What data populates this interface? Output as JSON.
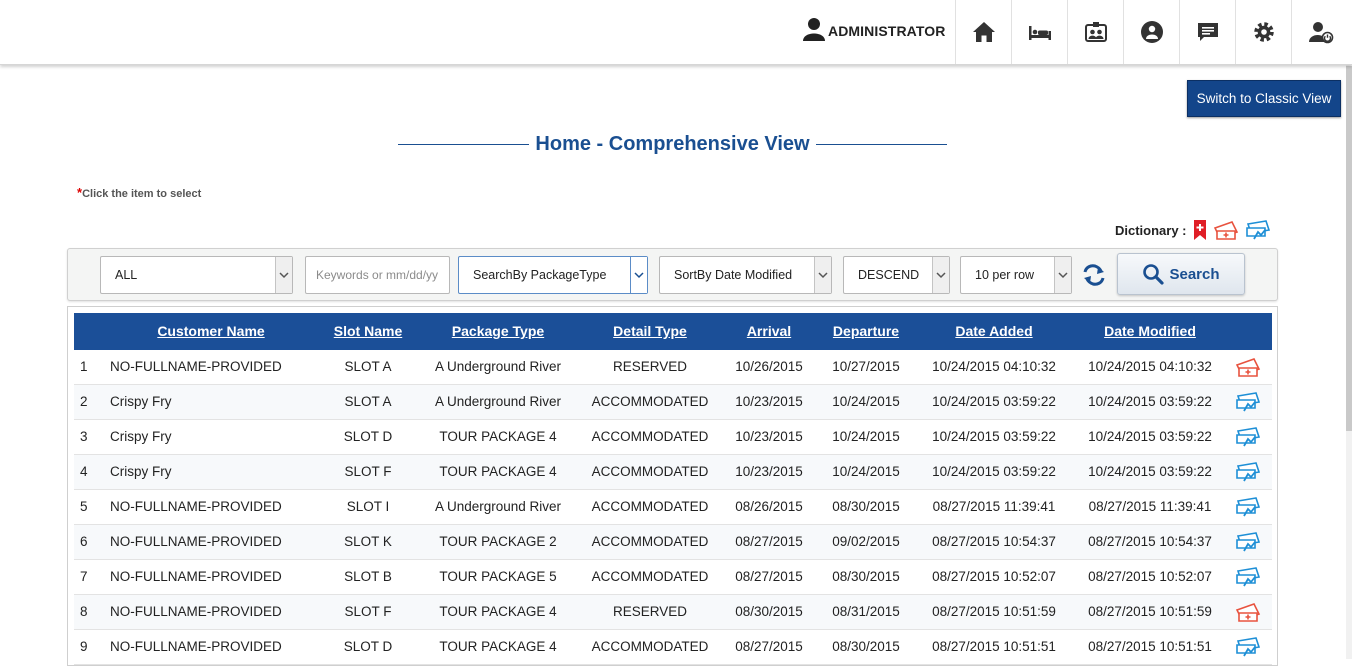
{
  "header": {
    "user_label": "ADMINISTRATOR",
    "nav_icons": [
      "home-icon",
      "bed-icon",
      "guest-card-icon",
      "support-icon",
      "message-icon",
      "settings-icon",
      "user-logout-icon"
    ]
  },
  "classic_view_button": "Switch to Classic View",
  "page_title": "Home - Comprehensive View",
  "hint": {
    "star": "*",
    "text": "Click the item to select"
  },
  "dictionary": {
    "label": "Dictionary :",
    "icons": [
      "bookmark-plus-icon",
      "reserved-icon",
      "accommodated-icon"
    ]
  },
  "filters": {
    "category": "ALL",
    "keyword_placeholder": "Keywords or mm/dd/yy",
    "search_by": "SearchBy PackageType",
    "sort_by": "SortBy Date Modified",
    "order": "DESCEND",
    "per_row": "10 per row",
    "search_button": "Search"
  },
  "table": {
    "headers": [
      "Customer Name",
      "Slot Name",
      "Package Type",
      "Detail Type",
      "Arrival",
      "Departure",
      "Date Added",
      "Date Modified"
    ],
    "rows": [
      {
        "no": "1",
        "customer": "NO-FULLNAME-PROVIDED",
        "slot": "SLOT A",
        "package": "A Underground River",
        "detail": "RESERVED",
        "arrival": "10/26/2015",
        "departure": "10/27/2015",
        "added": "10/24/2015 04:10:32",
        "modified": "10/24/2015 04:10:32",
        "icon": "reserved-icon"
      },
      {
        "no": "2",
        "customer": "Crispy Fry",
        "slot": "SLOT A",
        "package": "A Underground River",
        "detail": "ACCOMMODATED",
        "arrival": "10/23/2015",
        "departure": "10/24/2015",
        "added": "10/24/2015 03:59:22",
        "modified": "10/24/2015 03:59:22",
        "icon": "accommodated-icon"
      },
      {
        "no": "3",
        "customer": "Crispy Fry",
        "slot": "SLOT D",
        "package": "TOUR PACKAGE 4",
        "detail": "ACCOMMODATED",
        "arrival": "10/23/2015",
        "departure": "10/24/2015",
        "added": "10/24/2015 03:59:22",
        "modified": "10/24/2015 03:59:22",
        "icon": "accommodated-icon"
      },
      {
        "no": "4",
        "customer": "Crispy Fry",
        "slot": "SLOT F",
        "package": "TOUR PACKAGE 4",
        "detail": "ACCOMMODATED",
        "arrival": "10/23/2015",
        "departure": "10/24/2015",
        "added": "10/24/2015 03:59:22",
        "modified": "10/24/2015 03:59:22",
        "icon": "accommodated-icon"
      },
      {
        "no": "5",
        "customer": "NO-FULLNAME-PROVIDED",
        "slot": "SLOT I",
        "package": "A Underground River",
        "detail": "ACCOMMODATED",
        "arrival": "08/26/2015",
        "departure": "08/30/2015",
        "added": "08/27/2015 11:39:41",
        "modified": "08/27/2015 11:39:41",
        "icon": "accommodated-icon"
      },
      {
        "no": "6",
        "customer": "NO-FULLNAME-PROVIDED",
        "slot": "SLOT K",
        "package": "TOUR PACKAGE 2",
        "detail": "ACCOMMODATED",
        "arrival": "08/27/2015",
        "departure": "09/02/2015",
        "added": "08/27/2015 10:54:37",
        "modified": "08/27/2015 10:54:37",
        "icon": "accommodated-icon"
      },
      {
        "no": "7",
        "customer": "NO-FULLNAME-PROVIDED",
        "slot": "SLOT B",
        "package": "TOUR PACKAGE 5",
        "detail": "ACCOMMODATED",
        "arrival": "08/27/2015",
        "departure": "08/30/2015",
        "added": "08/27/2015 10:52:07",
        "modified": "08/27/2015 10:52:07",
        "icon": "accommodated-icon"
      },
      {
        "no": "8",
        "customer": "NO-FULLNAME-PROVIDED",
        "slot": "SLOT F",
        "package": "TOUR PACKAGE 4",
        "detail": "RESERVED",
        "arrival": "08/30/2015",
        "departure": "08/31/2015",
        "added": "08/27/2015 10:51:59",
        "modified": "08/27/2015 10:51:59",
        "icon": "reserved-icon"
      },
      {
        "no": "9",
        "customer": "NO-FULLNAME-PROVIDED",
        "slot": "SLOT D",
        "package": "TOUR PACKAGE 4",
        "detail": "ACCOMMODATED",
        "arrival": "08/27/2015",
        "departure": "08/30/2015",
        "added": "08/27/2015 10:51:51",
        "modified": "08/27/2015 10:51:51",
        "icon": "accommodated-icon"
      }
    ]
  },
  "colors": {
    "brand": "#1b4f98",
    "reserved": "#e8533f",
    "accommodated": "#1e8fd6"
  }
}
